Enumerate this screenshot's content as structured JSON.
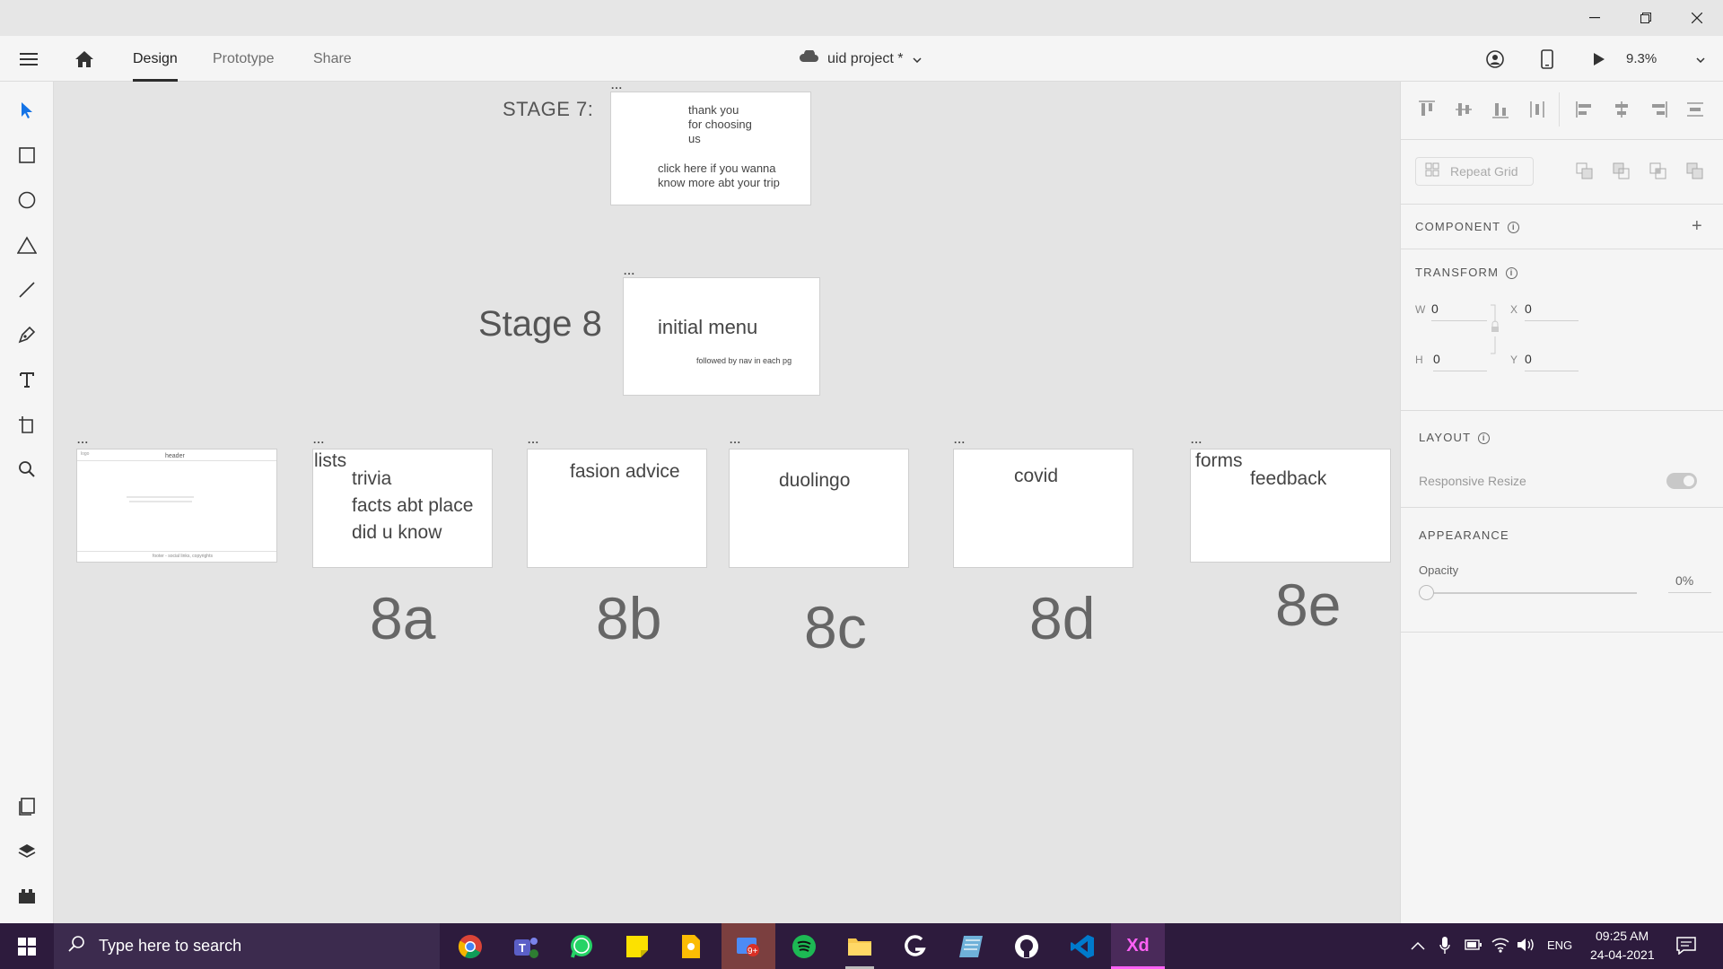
{
  "window": {
    "controls": [
      "minimize",
      "restore",
      "close"
    ]
  },
  "appbar": {
    "tabs": [
      {
        "label": "Design",
        "active": true
      },
      {
        "label": "Prototype",
        "active": false
      },
      {
        "label": "Share",
        "active": false
      }
    ],
    "document_title": "uid project *",
    "zoom": "9.3%"
  },
  "tools": [
    "select-icon",
    "rectangle-icon",
    "ellipse-icon",
    "polygon-icon",
    "line-icon",
    "pen-icon",
    "text-icon",
    "artboard-icon",
    "zoom-icon"
  ],
  "bottom_tools": [
    "assets-icon",
    "layers-icon",
    "plugins-icon"
  ],
  "canvas": {
    "stage7": {
      "label": "STAGE 7:",
      "dots": "...",
      "line1": "thank you",
      "line2": "for choosing",
      "line3": "us",
      "line4": "click here if you wanna",
      "line5": "know more abt your trip"
    },
    "stage8": {
      "label": "Stage 8",
      "dots": "...",
      "title": "initial menu",
      "subtitle": "followed by nav in each pg"
    },
    "artboards": [
      {
        "dots": "...",
        "header": "header",
        "logo": "logo",
        "footer": "footer - social links, copyrights",
        "number": ""
      },
      {
        "dots": "...",
        "corner": "lists",
        "lines": [
          "trivia",
          "facts abt place",
          "did u know"
        ],
        "number": "8a"
      },
      {
        "dots": "...",
        "title": "fasion advice",
        "number": "8b"
      },
      {
        "dots": "...",
        "title": "duolingo",
        "number": "8c"
      },
      {
        "dots": "...",
        "title": "covid",
        "number": "8d"
      },
      {
        "dots": "...",
        "corner": "forms",
        "title": "feedback",
        "number": "8e"
      }
    ]
  },
  "panel": {
    "repeat_grid": "Repeat Grid",
    "component_title": "COMPONENT",
    "transform_title": "TRANSFORM",
    "w_label": "W",
    "w_value": "0",
    "h_label": "H",
    "h_value": "0",
    "x_label": "X",
    "x_value": "0",
    "y_label": "Y",
    "y_value": "0",
    "layout_title": "LAYOUT",
    "responsive_resize": "Responsive Resize",
    "appearance_title": "APPEARANCE",
    "opacity_label": "Opacity",
    "opacity_value": "0%"
  },
  "taskbar": {
    "search_placeholder": "Type here to search",
    "apps": [
      "chrome-icon",
      "teams-icon",
      "whatsapp-icon",
      "sticky-notes-icon",
      "keep-icon",
      "photos-icon",
      "spotify-icon",
      "file-explorer-icon",
      "logitech-icon",
      "notes-icon",
      "github-icon",
      "vscode-icon",
      "adobe-xd-icon"
    ],
    "xd_label": "Xd",
    "photos_badge": "9+",
    "language": "ENG",
    "time": "09:25 AM",
    "date": "24-04-2021"
  },
  "colors": {
    "accent_blue": "#1473e6",
    "taskbar": "#2d1b3d",
    "xd_magenta": "#ff61f6"
  }
}
